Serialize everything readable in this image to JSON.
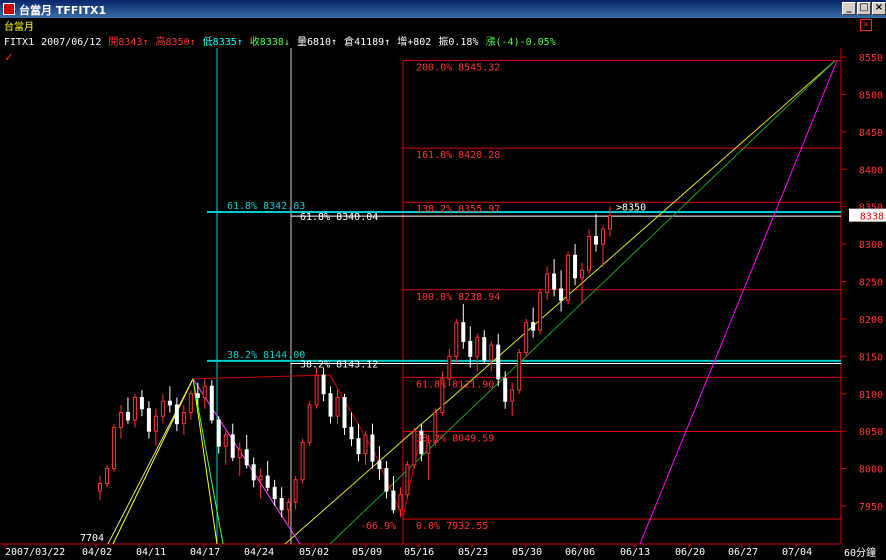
{
  "window": {
    "title": "台當月 TFFITX1",
    "minimize": "_",
    "maximize": "□",
    "close": "×"
  },
  "header": {
    "name": "台當月",
    "symbol": "FITX1",
    "date": "2007/06/12",
    "open": "開8343↑",
    "high": "高8350↑",
    "low": "低8335↑",
    "close": "收8338↓",
    "volume": "量6810↑",
    "oi": "倉41189↑",
    "oi_change": "增+802",
    "amplitude": "振0.18%",
    "change": "漲(-4)-0.05%"
  },
  "chart_data": {
    "type": "candlestick",
    "timeframe": "60分鐘",
    "ylim": [
      7920,
      8570
    ],
    "y_ticks": [
      7950,
      8000,
      8050,
      8100,
      8150,
      8200,
      8250,
      8300,
      8350,
      8400,
      8450,
      8500,
      8550
    ],
    "x_ticks": [
      "2007/03/22",
      "04/02",
      "04/11",
      "04/17",
      "04/24",
      "05/02",
      "05/09",
      "05/16",
      "05/23",
      "05/30",
      "06/06",
      "06/13",
      "06/20",
      "06/27",
      "07/04"
    ],
    "current_price": 8338,
    "last_price_label": ">8350",
    "low_label": "7704",
    "fib_left": [
      {
        "label": "61.8% 8342.83",
        "value": 8342.83
      },
      {
        "label": "38.2% 8144.00",
        "value": 8144.0
      }
    ],
    "fib_mid": [
      {
        "label": "61.8% 8340.04",
        "value": 8340.04
      },
      {
        "label": "38.2% 8143.12",
        "value": 8143.12
      }
    ],
    "fib_right": [
      {
        "label": "200.0% 8545.32",
        "value": 8545.32
      },
      {
        "label": "161.8% 8428.28",
        "value": 8428.28
      },
      {
        "label": "138.2% 8355.97",
        "value": 8355.97
      },
      {
        "label": "100.0% 8238.94",
        "value": 8238.94
      },
      {
        "label": "61.8% 8121.90",
        "value": 8121.9
      },
      {
        "label": "38.2% 8049.59",
        "value": 8049.59
      },
      {
        "label": "0.0% 7932.55",
        "value": 7932.55
      }
    ],
    "neg_label": "-66.9%",
    "candles": [
      [
        7970,
        7990,
        7958,
        7980
      ],
      [
        7980,
        8005,
        7975,
        8000
      ],
      [
        8000,
        8060,
        7995,
        8055
      ],
      [
        8055,
        8085,
        8040,
        8075
      ],
      [
        8075,
        8095,
        8060,
        8065
      ],
      [
        8065,
        8100,
        8055,
        8095
      ],
      [
        8095,
        8105,
        8070,
        8080
      ],
      [
        8080,
        8090,
        8040,
        8050
      ],
      [
        8050,
        8080,
        8030,
        8070
      ],
      [
        8070,
        8100,
        8060,
        8090
      ],
      [
        8090,
        8110,
        8075,
        8085
      ],
      [
        8085,
        8095,
        8050,
        8060
      ],
      [
        8060,
        8085,
        8045,
        8075
      ],
      [
        8075,
        8105,
        8065,
        8100
      ],
      [
        8100,
        8115,
        8085,
        8095
      ],
      [
        8095,
        8120,
        8080,
        8110
      ],
      [
        8110,
        8118,
        8060,
        8065
      ],
      [
        8065,
        8070,
        8020,
        8030
      ],
      [
        8030,
        8050,
        8005,
        8045
      ],
      [
        8045,
        8060,
        8010,
        8015
      ],
      [
        8015,
        8035,
        7990,
        8025
      ],
      [
        8025,
        8045,
        8000,
        8005
      ],
      [
        8005,
        8015,
        7975,
        7985
      ],
      [
        7985,
        8000,
        7960,
        7990
      ],
      [
        7990,
        8010,
        7970,
        7975
      ],
      [
        7975,
        7985,
        7950,
        7960
      ],
      [
        7960,
        7975,
        7935,
        7945
      ],
      [
        7945,
        7960,
        7925,
        7955
      ],
      [
        7955,
        7990,
        7945,
        7985
      ],
      [
        7985,
        8040,
        7980,
        8035
      ],
      [
        8035,
        8090,
        8030,
        8085
      ],
      [
        8085,
        8135,
        8080,
        8125
      ],
      [
        8125,
        8135,
        8090,
        8100
      ],
      [
        8100,
        8110,
        8060,
        8070
      ],
      [
        8070,
        8105,
        8060,
        8095
      ],
      [
        8095,
        8100,
        8045,
        8055
      ],
      [
        8055,
        8075,
        8030,
        8040
      ],
      [
        8040,
        8060,
        8010,
        8020
      ],
      [
        8020,
        8050,
        8005,
        8045
      ],
      [
        8045,
        8060,
        8000,
        8010
      ],
      [
        8010,
        8030,
        7985,
        8000
      ],
      [
        8000,
        8010,
        7960,
        7970
      ],
      [
        7970,
        7990,
        7940,
        7945
      ],
      [
        7945,
        7975,
        7935,
        7965
      ],
      [
        7965,
        8010,
        7960,
        8005
      ],
      [
        8005,
        8055,
        8000,
        8050
      ],
      [
        8050,
        8060,
        8010,
        8020
      ],
      [
        8020,
        8045,
        7985,
        8035
      ],
      [
        8035,
        8080,
        8030,
        8075
      ],
      [
        8075,
        8130,
        8070,
        8120
      ],
      [
        8120,
        8160,
        8110,
        8150
      ],
      [
        8150,
        8200,
        8140,
        8195
      ],
      [
        8195,
        8220,
        8160,
        8170
      ],
      [
        8170,
        8190,
        8135,
        8150
      ],
      [
        8150,
        8180,
        8130,
        8175
      ],
      [
        8175,
        8185,
        8140,
        8145
      ],
      [
        8145,
        8170,
        8130,
        8165
      ],
      [
        8165,
        8180,
        8110,
        8120
      ],
      [
        8120,
        8130,
        8080,
        8090
      ],
      [
        8090,
        8115,
        8070,
        8105
      ],
      [
        8105,
        8160,
        8100,
        8155
      ],
      [
        8155,
        8200,
        8150,
        8195
      ],
      [
        8195,
        8215,
        8175,
        8185
      ],
      [
        8185,
        8240,
        8180,
        8235
      ],
      [
        8235,
        8270,
        8225,
        8260
      ],
      [
        8260,
        8280,
        8230,
        8240
      ],
      [
        8240,
        8265,
        8210,
        8225
      ],
      [
        8225,
        8290,
        8220,
        8285
      ],
      [
        8285,
        8300,
        8245,
        8255
      ],
      [
        8255,
        8275,
        8220,
        8265
      ],
      [
        8265,
        8320,
        8260,
        8310
      ],
      [
        8310,
        8340,
        8290,
        8300
      ],
      [
        8300,
        8325,
        8270,
        8320
      ],
      [
        8320,
        8350,
        8310,
        8338
      ]
    ]
  },
  "status": {
    "timeframe": "60分鐘"
  }
}
